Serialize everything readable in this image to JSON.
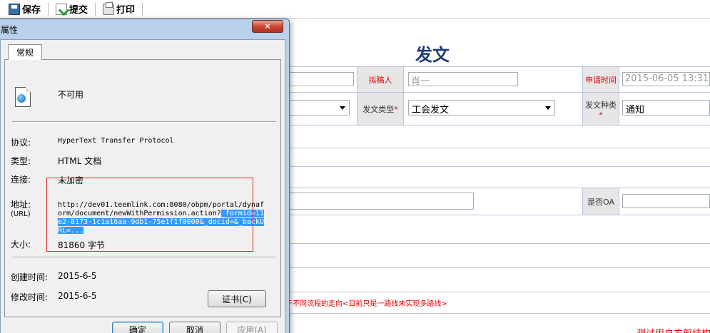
{
  "toolbar": {
    "save": "保存",
    "submit": "提交",
    "print": "打印"
  },
  "form": {
    "title": "发文",
    "drafter_label": "拟稿人",
    "drafter_value": "肖一",
    "apply_time_label": "申请时间",
    "apply_time_value": "2015-06-05 13:31",
    "doc_type_label": "发文类型",
    "doc_type_value": "工会发文",
    "doc_kind_label": "发文种类",
    "doc_kind_value": "通知",
    "is_oa_label": "是否OA",
    "required_mark": "*",
    "flow_note": "于不同流程的走向<目前只是一路线未实现多路线>",
    "bottom_red_text": "测试用户方部结构"
  },
  "dialog": {
    "title": "属性",
    "close": "✕",
    "tab_general": "常规",
    "file_name_value": "不可用",
    "protocol_label": "协议:",
    "protocol_value": "HyperText Transfer Protocol",
    "type_label": "类型:",
    "type_value": "HTML 文档",
    "connection_label": "连接:",
    "connection_value": "未加密",
    "address_label": "地址:",
    "address_sub": "(URL)",
    "url_line1": "http://dev01.teemlink.com:8080/obpm/portal/dynaform/document/newWithPermission.action?",
    "url_selected": "_formid=11e2-8173-1c1a16aa-9db1-",
    "url_cut": "75e1f1f0000&_docid=&_backURL=...",
    "size_label": "大小:",
    "size_value": "81860 字节",
    "created_label": "创建时间:",
    "created_value": "2015-6-5",
    "modified_label": "修改时间:",
    "modified_value": "2015-6-5",
    "cert_button": "证书(C)",
    "ok_button": "确定",
    "cancel_button": "取消",
    "apply_button": "应用(A)"
  },
  "colors": {
    "dialog_frame": "#b9d1ea",
    "form_title": "#1f3a7a",
    "red_highlight": "#e0262a",
    "selection": "#3399ff"
  }
}
